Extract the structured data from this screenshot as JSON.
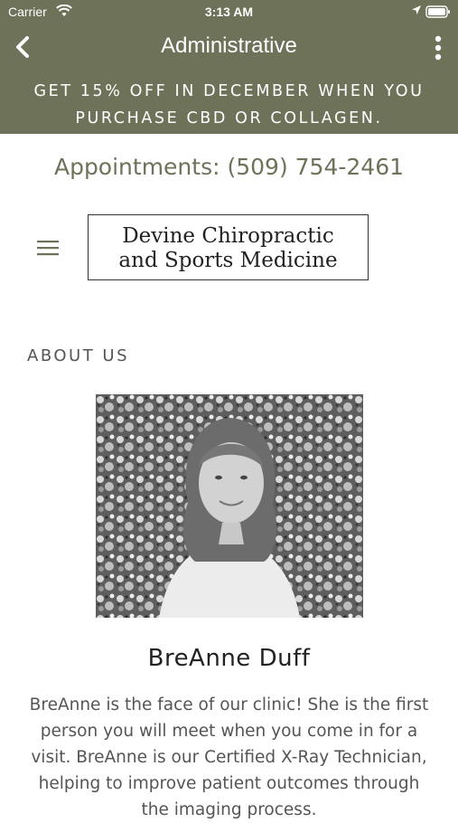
{
  "status": {
    "carrier": "Carrier",
    "time": "3:13 AM"
  },
  "nav": {
    "title": "Administrative"
  },
  "promo": {
    "line1": "GET 15% OFF IN DECEMBER WHEN YOU",
    "line2": "PURCHASE CBD OR COLLAGEN."
  },
  "appointments": "Appointments: (509) 754-2461",
  "logo": {
    "line1": "Devine Chiropractic",
    "line2": "and Sports Medicine"
  },
  "section_title": "ABOUT US",
  "person": {
    "name": "BreAnne Duff",
    "bio": "BreAnne is the face of our clinic! She is the first person you will meet when you come in for a visit. BreAnne is our Certified X-Ray Technician, helping to improve patient outcomes through the imaging process."
  },
  "colors": {
    "brand": "#6e7259"
  },
  "icons": [
    "wifi-icon",
    "location-arrow-icon",
    "battery-icon",
    "back-chevron-icon",
    "more-vertical-icon",
    "hamburger-menu-icon"
  ]
}
